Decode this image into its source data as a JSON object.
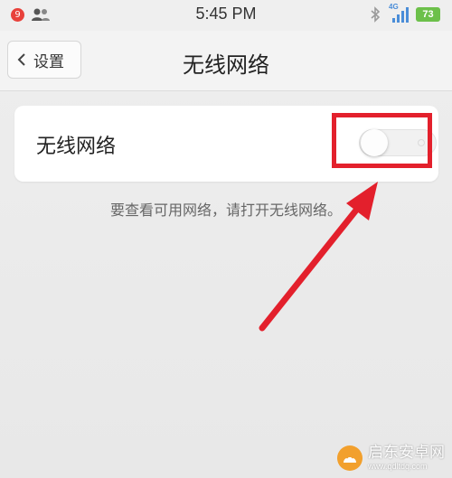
{
  "status_bar": {
    "notification_count": "9",
    "time": "5:45 PM",
    "network_type": "4G",
    "battery_level": "73",
    "icons": [
      "contacts-icon",
      "bluetooth-icon",
      "signal-icon",
      "battery-icon"
    ]
  },
  "nav": {
    "back_label": "设置",
    "title": "无线网络"
  },
  "wifi": {
    "label": "无线网络",
    "enabled": false
  },
  "hint": "要查看可用网络，请打开无线网络。",
  "watermark": {
    "name": "启东安卓网",
    "url": "www.qdltdq.com"
  },
  "colors": {
    "highlight": "#e3202c",
    "battery": "#6cc04a",
    "badge": "#e8413b"
  }
}
